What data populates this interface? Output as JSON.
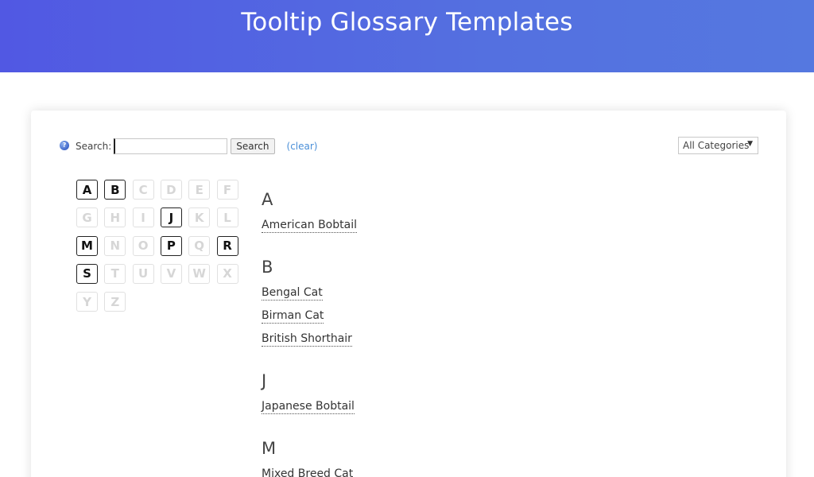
{
  "header": {
    "title": "Tooltip Glossary Templates"
  },
  "search": {
    "help_icon": "question-icon",
    "label": "Search:",
    "value": "",
    "button_label": "Search",
    "clear_label": "(clear)"
  },
  "category": {
    "selected": "All Categories"
  },
  "alphabet": [
    {
      "letter": "A",
      "active": true
    },
    {
      "letter": "B",
      "active": true
    },
    {
      "letter": "C",
      "active": false
    },
    {
      "letter": "D",
      "active": false
    },
    {
      "letter": "E",
      "active": false
    },
    {
      "letter": "F",
      "active": false
    },
    {
      "letter": "G",
      "active": false
    },
    {
      "letter": "H",
      "active": false
    },
    {
      "letter": "I",
      "active": false
    },
    {
      "letter": "J",
      "active": true
    },
    {
      "letter": "K",
      "active": false
    },
    {
      "letter": "L",
      "active": false
    },
    {
      "letter": "M",
      "active": true
    },
    {
      "letter": "N",
      "active": false
    },
    {
      "letter": "O",
      "active": false
    },
    {
      "letter": "P",
      "active": true
    },
    {
      "letter": "Q",
      "active": false
    },
    {
      "letter": "R",
      "active": true
    },
    {
      "letter": "S",
      "active": true
    },
    {
      "letter": "T",
      "active": false
    },
    {
      "letter": "U",
      "active": false
    },
    {
      "letter": "V",
      "active": false
    },
    {
      "letter": "W",
      "active": false
    },
    {
      "letter": "X",
      "active": false
    },
    {
      "letter": "Y",
      "active": false
    },
    {
      "letter": "Z",
      "active": false
    }
  ],
  "sections": [
    {
      "heading": "A",
      "terms": [
        "American Bobtail"
      ]
    },
    {
      "heading": "B",
      "terms": [
        "Bengal Cat",
        "Birman Cat",
        "British Shorthair"
      ]
    },
    {
      "heading": "J",
      "terms": [
        "Japanese Bobtail"
      ]
    },
    {
      "heading": "M",
      "terms": [
        "Mixed Breed Cat"
      ]
    }
  ]
}
